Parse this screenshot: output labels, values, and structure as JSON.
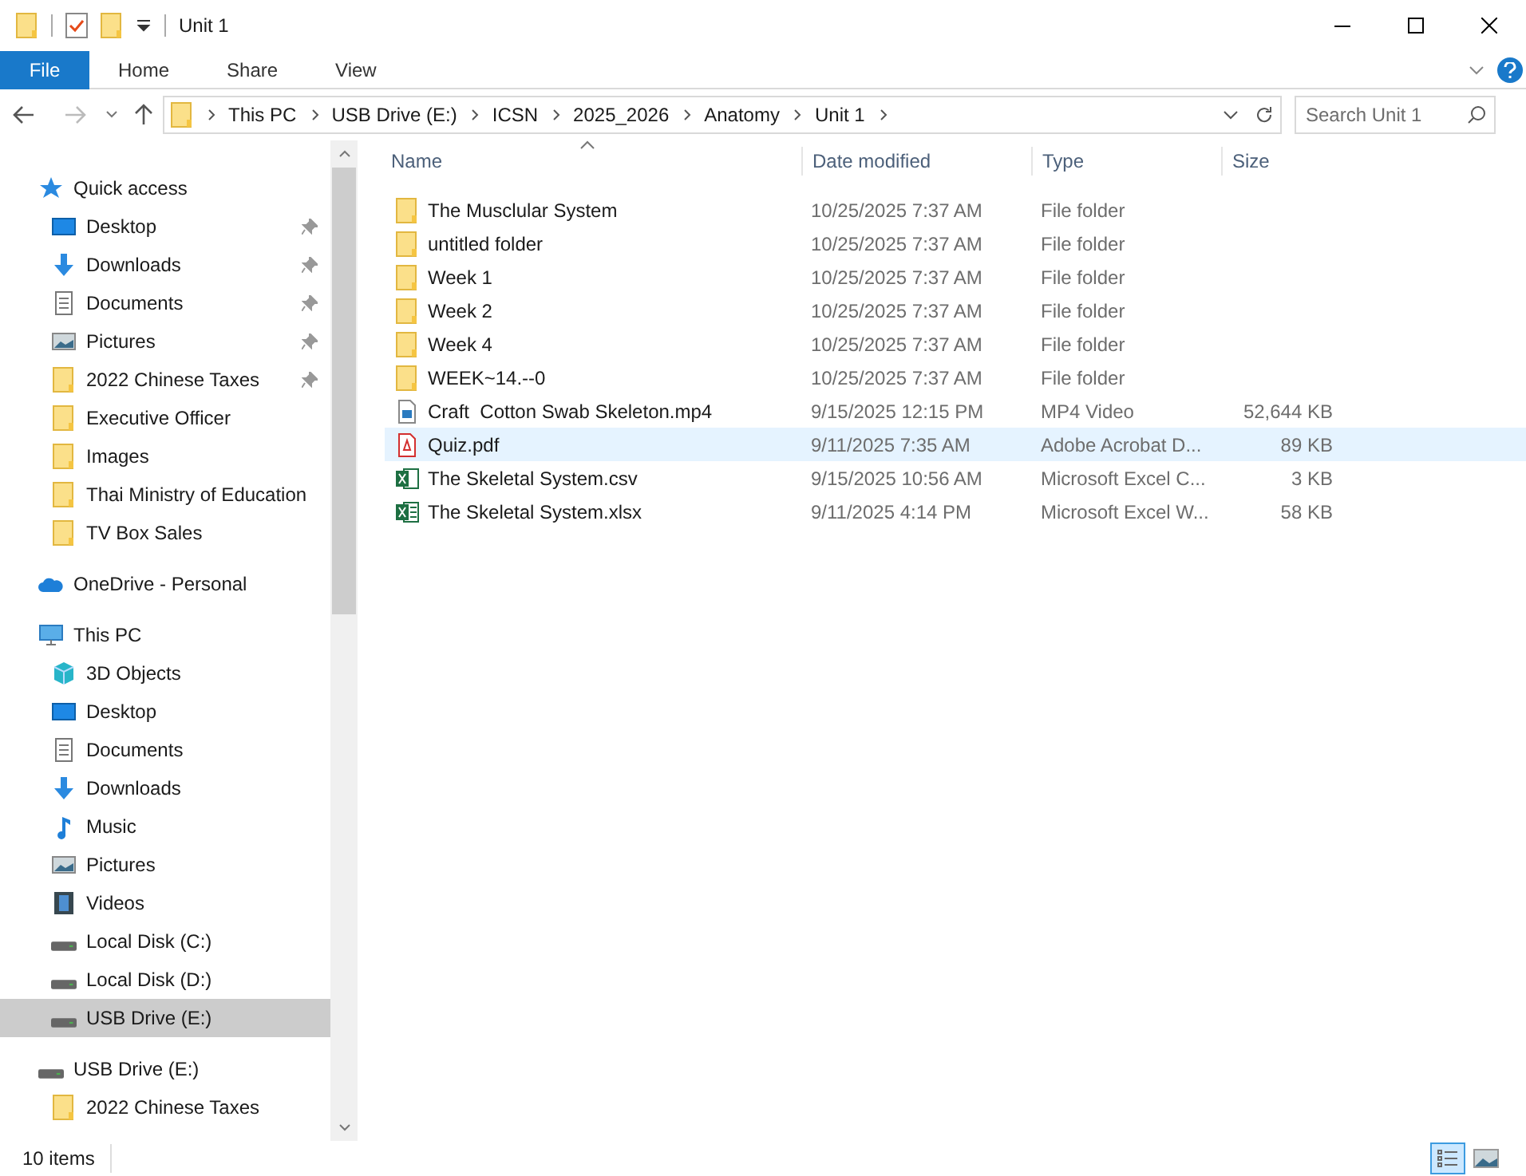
{
  "window": {
    "title": "Unit 1"
  },
  "ribbon_tabs": [
    {
      "label": "File",
      "selected": true
    },
    {
      "label": "Home",
      "selected": false
    },
    {
      "label": "Share",
      "selected": false
    },
    {
      "label": "View",
      "selected": false
    }
  ],
  "breadcrumbs": [
    "This PC",
    "USB Drive (E:)",
    "ICSN",
    "2025_2026",
    "Anatomy",
    "Unit 1"
  ],
  "search": {
    "placeholder": "Search Unit 1"
  },
  "sidebar": {
    "items": [
      {
        "label": "Quick access",
        "kind": "star",
        "selected": false,
        "children": [
          {
            "label": "Desktop",
            "kind": "desktop",
            "pinned": true,
            "selected": false
          },
          {
            "label": "Downloads",
            "kind": "download",
            "pinned": true,
            "selected": false
          },
          {
            "label": "Documents",
            "kind": "document",
            "pinned": true,
            "selected": false
          },
          {
            "label": "Pictures",
            "kind": "picture",
            "pinned": true,
            "selected": false
          },
          {
            "label": "2022 Chinese Taxes",
            "kind": "folder",
            "pinned": true,
            "selected": false
          },
          {
            "label": "Executive Officer",
            "kind": "folder",
            "pinned": false,
            "selected": false
          },
          {
            "label": "Images",
            "kind": "folder",
            "pinned": false,
            "selected": false
          },
          {
            "label": "Thai Ministry of Education",
            "kind": "folder",
            "pinned": false,
            "selected": false
          },
          {
            "label": "TV Box Sales",
            "kind": "folder",
            "pinned": false,
            "selected": false
          }
        ]
      },
      {
        "label": "OneDrive - Personal",
        "kind": "cloud",
        "selected": false
      },
      {
        "label": "This PC",
        "kind": "pc",
        "selected": false,
        "children": [
          {
            "label": "3D Objects",
            "kind": "cube",
            "selected": false
          },
          {
            "label": "Desktop",
            "kind": "desktop",
            "selected": false
          },
          {
            "label": "Documents",
            "kind": "document",
            "selected": false
          },
          {
            "label": "Downloads",
            "kind": "download",
            "selected": false
          },
          {
            "label": "Music",
            "kind": "music",
            "selected": false
          },
          {
            "label": "Pictures",
            "kind": "picture",
            "selected": false
          },
          {
            "label": "Videos",
            "kind": "video",
            "selected": false
          },
          {
            "label": "Local Disk (C:)",
            "kind": "drive",
            "selected": false
          },
          {
            "label": "Local Disk (D:)",
            "kind": "drive",
            "selected": false
          },
          {
            "label": "USB Drive (E:)",
            "kind": "drive",
            "selected": true
          }
        ]
      },
      {
        "label": "USB Drive (E:)",
        "kind": "drive",
        "selected": false,
        "children": [
          {
            "label": "2022 Chinese Taxes",
            "kind": "folder",
            "selected": false
          }
        ]
      }
    ]
  },
  "table": {
    "columns": [
      "Name",
      "Date modified",
      "Type",
      "Size"
    ],
    "rows": [
      {
        "kind": "folder",
        "name": "The Musclular System",
        "date": "10/25/2025 7:37 AM",
        "type": "File folder",
        "selected": false
      },
      {
        "kind": "folder",
        "name": "untitled folder",
        "date": "10/25/2025 7:37 AM",
        "type": "File folder",
        "selected": false
      },
      {
        "kind": "folder",
        "name": "Week 1",
        "date": "10/25/2025 7:37 AM",
        "type": "File folder",
        "selected": false
      },
      {
        "kind": "folder",
        "name": "Week 2",
        "date": "10/25/2025 7:37 AM",
        "type": "File folder",
        "selected": false
      },
      {
        "kind": "folder",
        "name": "Week 4",
        "date": "10/25/2025 7:37 AM",
        "type": "File folder",
        "selected": false
      },
      {
        "kind": "folder",
        "name": "WEEK~14.--0",
        "date": "10/25/2025 7:37 AM",
        "type": "File folder",
        "selected": false
      },
      {
        "kind": "video",
        "name": "Craft  Cotton Swab Skeleton.mp4",
        "date": "9/15/2025 12:15 PM",
        "type": "MP4 Video",
        "size": "52,644 KB",
        "selected": false
      },
      {
        "kind": "pdf",
        "name": "Quiz.pdf",
        "date": "9/11/2025 7:35 AM",
        "type": "Adobe Acrobat D...",
        "size": "89 KB",
        "selected": true
      },
      {
        "kind": "csv",
        "name": "The Skeletal System.csv",
        "date": "9/15/2025 10:56 AM",
        "type": "Microsoft Excel C...",
        "size": "3 KB",
        "selected": false
      },
      {
        "kind": "excel",
        "name": "The Skeletal System.xlsx",
        "date": "9/11/2025 4:14 PM",
        "type": "Microsoft Excel W...",
        "size": "58 KB",
        "selected": false
      }
    ]
  },
  "status_bar": {
    "item_count": "10 items"
  }
}
